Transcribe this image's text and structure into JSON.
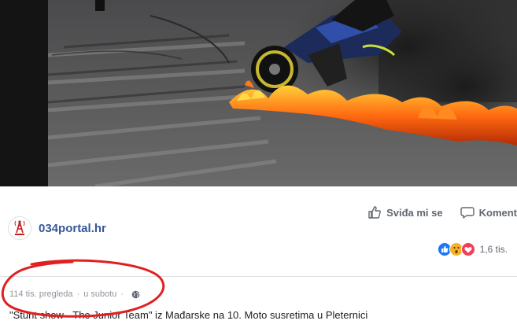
{
  "post": {
    "page_name": "034portal.hr",
    "avatar_icon": "radio-tower-logo-icon",
    "actions": {
      "like_label": "Sviđa mi se",
      "like_icon": "thumbs-up-icon",
      "comment_label": "Koment",
      "comment_icon": "speech-bubble-icon"
    },
    "reactions": {
      "icons": [
        "like-reaction-icon",
        "wow-reaction-icon",
        "love-reaction-icon"
      ],
      "count": "1,6 tis."
    },
    "views": "114 tis. pregleda",
    "separator": "·",
    "date": "u subotu",
    "privacy_icon": "globe-icon",
    "caption": "\"Stunt show - The Junior Team\" iz Mađarske na 10. Moto susretima u Pleternici"
  },
  "colors": {
    "page_name": "#365899",
    "meta_text": "#90949c",
    "action_text": "#606770",
    "like_reaction": "#1877f2",
    "wow_reaction": "#f7b125",
    "love_reaction": "#f33e58",
    "annotation_circle": "#e02020"
  }
}
